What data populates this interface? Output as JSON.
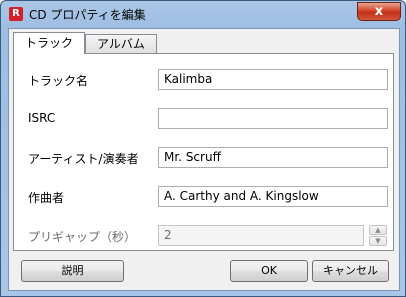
{
  "window": {
    "title": "CD プロパティを編集",
    "app_icon_glyph": "R",
    "close_glyph": "x"
  },
  "tabs": [
    {
      "label": "トラック",
      "active": true
    },
    {
      "label": "アルバム",
      "active": false
    }
  ],
  "fields": {
    "track_name": {
      "label": "トラック名",
      "value": "Kalimba"
    },
    "isrc": {
      "label": "ISRC",
      "value": ""
    },
    "artist": {
      "label": "アーティスト/演奏者",
      "value": "Mr. Scruff"
    },
    "composer": {
      "label": "作曲者",
      "value": "A. Carthy and A. Kingslow"
    },
    "pregap": {
      "label": "プリギャップ（秒）",
      "value": "2",
      "disabled": true
    }
  },
  "buttons": {
    "help": "説明",
    "ok": "OK",
    "cancel": "キャンセル"
  },
  "icons": {
    "spin_up": "▲",
    "spin_down": "▼"
  }
}
